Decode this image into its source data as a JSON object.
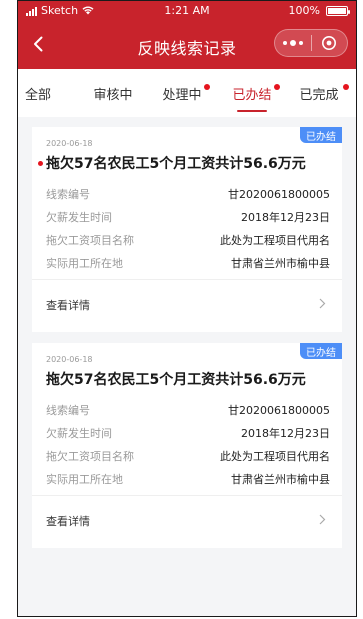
{
  "status_bar": {
    "carrier": "Sketch",
    "time": "1:21 AM",
    "battery": "100%"
  },
  "nav": {
    "title": "反映线索记录",
    "back_icon": "back-arrow-icon",
    "more_icon": "more-dots-icon",
    "target_icon": "target-icon"
  },
  "colors": {
    "brand_red": "#c8232c",
    "badge_blue": "#4d8ef7",
    "dot_red": "#e5141e"
  },
  "tabs": [
    {
      "label": "全部",
      "has_dot": false,
      "active": false
    },
    {
      "label": "审核中",
      "has_dot": false,
      "active": false
    },
    {
      "label": "处理中",
      "has_dot": true,
      "active": false
    },
    {
      "label": "已办结",
      "has_dot": true,
      "active": true
    },
    {
      "label": "已完成",
      "has_dot": true,
      "active": false
    }
  ],
  "cards": [
    {
      "date": "2020-06-18",
      "badge": "已办结",
      "title": "拖欠57名农民工5个月工资共计56.6万元",
      "unread": true,
      "rows": [
        {
          "key": "线索编号",
          "value": "甘2020061800005"
        },
        {
          "key": "欠薪发生时间",
          "value": "2018年12月23日"
        },
        {
          "key": "拖欠工资项目名称",
          "value": "此处为工程项目代用名"
        },
        {
          "key": "实际用工所在地",
          "value": "甘肃省兰州市榆中县"
        }
      ],
      "detail_label": "查看详情"
    },
    {
      "date": "2020-06-18",
      "badge": "已办结",
      "title": "拖欠57名农民工5个月工资共计56.6万元",
      "unread": false,
      "rows": [
        {
          "key": "线索编号",
          "value": "甘2020061800005"
        },
        {
          "key": "欠薪发生时间",
          "value": "2018年12月23日"
        },
        {
          "key": "拖欠工资项目名称",
          "value": "此处为工程项目代用名"
        },
        {
          "key": "实际用工所在地",
          "value": "甘肃省兰州市榆中县"
        }
      ],
      "detail_label": "查看详情"
    }
  ]
}
